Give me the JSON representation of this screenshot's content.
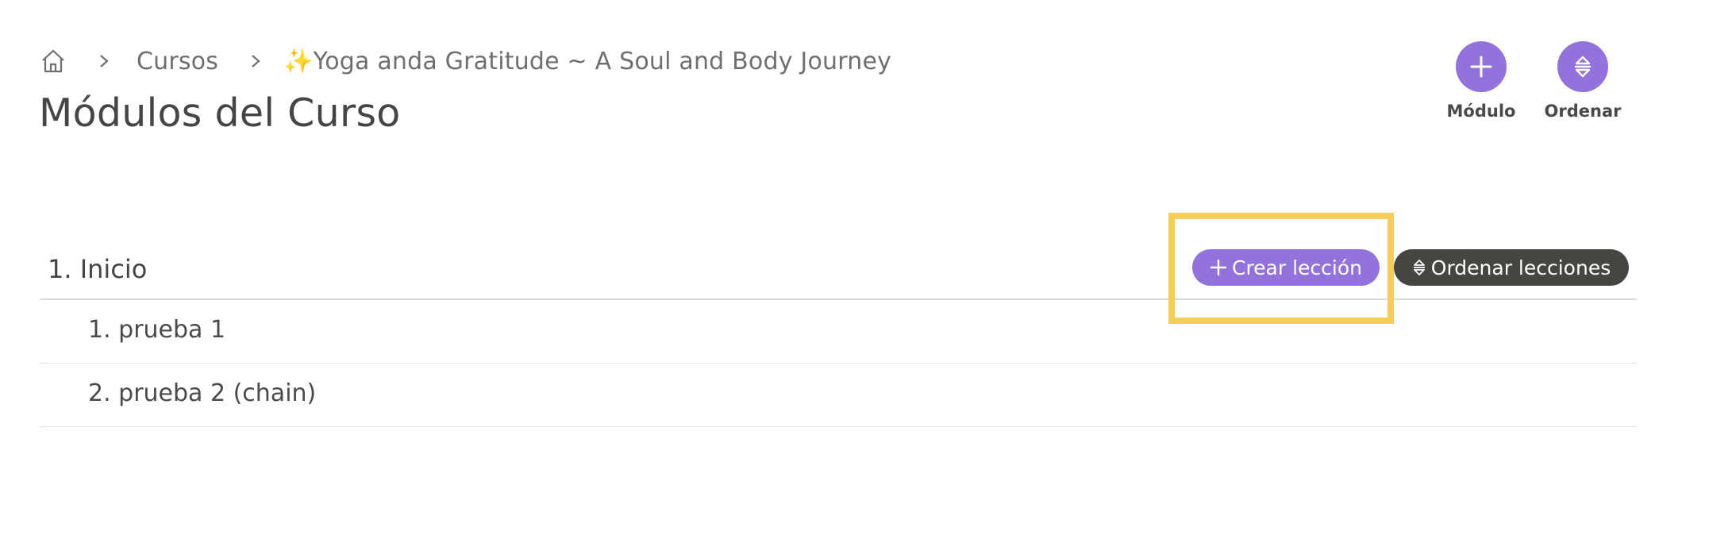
{
  "breadcrumb": {
    "home_icon": "home-icon",
    "items": [
      "Cursos",
      "✨Yoga anda Gratitude ~ A Soul and Body Journey"
    ]
  },
  "page_title": "Módulos del Curso",
  "actions": {
    "module": {
      "label": "Módulo",
      "icon": "plus-icon"
    },
    "order": {
      "label": "Ordenar",
      "icon": "sort-icon"
    }
  },
  "module": {
    "title": "1. Inicio",
    "create_lesson_label": "Crear lección",
    "order_lessons_label": "Ordenar lecciones",
    "lessons": [
      "1. prueba 1",
      "2. prueba 2 (chain)"
    ]
  },
  "colors": {
    "accent": "#9272db",
    "dark_button": "#454542",
    "highlight": "#f3cd5a"
  }
}
